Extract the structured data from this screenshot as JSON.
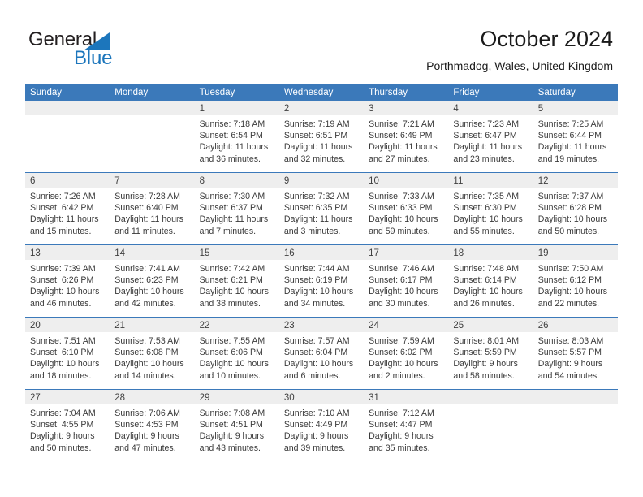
{
  "brand": {
    "name_top": "General",
    "name_bottom": "Blue",
    "triangle_icon": "triangle-icon",
    "color_text": "#231f20",
    "color_blue": "#1c76bc"
  },
  "header": {
    "title": "October 2024",
    "subtitle": "Porthmadog, Wales, United Kingdom"
  },
  "theme": {
    "header_blue": "#3b79ba",
    "day_band_gray": "#eeeeee",
    "text_color": "#3a3a3a"
  },
  "weekdays": [
    "Sunday",
    "Monday",
    "Tuesday",
    "Wednesday",
    "Thursday",
    "Friday",
    "Saturday"
  ],
  "weeks": [
    [
      {
        "day": "",
        "empty": true,
        "sunrise": "",
        "sunset": "",
        "daylight_a": "",
        "daylight_b": ""
      },
      {
        "day": "",
        "empty": true,
        "sunrise": "",
        "sunset": "",
        "daylight_a": "",
        "daylight_b": ""
      },
      {
        "day": "1",
        "sunrise": "Sunrise: 7:18 AM",
        "sunset": "Sunset: 6:54 PM",
        "daylight_a": "Daylight: 11 hours",
        "daylight_b": "and 36 minutes."
      },
      {
        "day": "2",
        "sunrise": "Sunrise: 7:19 AM",
        "sunset": "Sunset: 6:51 PM",
        "daylight_a": "Daylight: 11 hours",
        "daylight_b": "and 32 minutes."
      },
      {
        "day": "3",
        "sunrise": "Sunrise: 7:21 AM",
        "sunset": "Sunset: 6:49 PM",
        "daylight_a": "Daylight: 11 hours",
        "daylight_b": "and 27 minutes."
      },
      {
        "day": "4",
        "sunrise": "Sunrise: 7:23 AM",
        "sunset": "Sunset: 6:47 PM",
        "daylight_a": "Daylight: 11 hours",
        "daylight_b": "and 23 minutes."
      },
      {
        "day": "5",
        "sunrise": "Sunrise: 7:25 AM",
        "sunset": "Sunset: 6:44 PM",
        "daylight_a": "Daylight: 11 hours",
        "daylight_b": "and 19 minutes."
      }
    ],
    [
      {
        "day": "6",
        "sunrise": "Sunrise: 7:26 AM",
        "sunset": "Sunset: 6:42 PM",
        "daylight_a": "Daylight: 11 hours",
        "daylight_b": "and 15 minutes."
      },
      {
        "day": "7",
        "sunrise": "Sunrise: 7:28 AM",
        "sunset": "Sunset: 6:40 PM",
        "daylight_a": "Daylight: 11 hours",
        "daylight_b": "and 11 minutes."
      },
      {
        "day": "8",
        "sunrise": "Sunrise: 7:30 AM",
        "sunset": "Sunset: 6:37 PM",
        "daylight_a": "Daylight: 11 hours",
        "daylight_b": "and 7 minutes."
      },
      {
        "day": "9",
        "sunrise": "Sunrise: 7:32 AM",
        "sunset": "Sunset: 6:35 PM",
        "daylight_a": "Daylight: 11 hours",
        "daylight_b": "and 3 minutes."
      },
      {
        "day": "10",
        "sunrise": "Sunrise: 7:33 AM",
        "sunset": "Sunset: 6:33 PM",
        "daylight_a": "Daylight: 10 hours",
        "daylight_b": "and 59 minutes."
      },
      {
        "day": "11",
        "sunrise": "Sunrise: 7:35 AM",
        "sunset": "Sunset: 6:30 PM",
        "daylight_a": "Daylight: 10 hours",
        "daylight_b": "and 55 minutes."
      },
      {
        "day": "12",
        "sunrise": "Sunrise: 7:37 AM",
        "sunset": "Sunset: 6:28 PM",
        "daylight_a": "Daylight: 10 hours",
        "daylight_b": "and 50 minutes."
      }
    ],
    [
      {
        "day": "13",
        "sunrise": "Sunrise: 7:39 AM",
        "sunset": "Sunset: 6:26 PM",
        "daylight_a": "Daylight: 10 hours",
        "daylight_b": "and 46 minutes."
      },
      {
        "day": "14",
        "sunrise": "Sunrise: 7:41 AM",
        "sunset": "Sunset: 6:23 PM",
        "daylight_a": "Daylight: 10 hours",
        "daylight_b": "and 42 minutes."
      },
      {
        "day": "15",
        "sunrise": "Sunrise: 7:42 AM",
        "sunset": "Sunset: 6:21 PM",
        "daylight_a": "Daylight: 10 hours",
        "daylight_b": "and 38 minutes."
      },
      {
        "day": "16",
        "sunrise": "Sunrise: 7:44 AM",
        "sunset": "Sunset: 6:19 PM",
        "daylight_a": "Daylight: 10 hours",
        "daylight_b": "and 34 minutes."
      },
      {
        "day": "17",
        "sunrise": "Sunrise: 7:46 AM",
        "sunset": "Sunset: 6:17 PM",
        "daylight_a": "Daylight: 10 hours",
        "daylight_b": "and 30 minutes."
      },
      {
        "day": "18",
        "sunrise": "Sunrise: 7:48 AM",
        "sunset": "Sunset: 6:14 PM",
        "daylight_a": "Daylight: 10 hours",
        "daylight_b": "and 26 minutes."
      },
      {
        "day": "19",
        "sunrise": "Sunrise: 7:50 AM",
        "sunset": "Sunset: 6:12 PM",
        "daylight_a": "Daylight: 10 hours",
        "daylight_b": "and 22 minutes."
      }
    ],
    [
      {
        "day": "20",
        "sunrise": "Sunrise: 7:51 AM",
        "sunset": "Sunset: 6:10 PM",
        "daylight_a": "Daylight: 10 hours",
        "daylight_b": "and 18 minutes."
      },
      {
        "day": "21",
        "sunrise": "Sunrise: 7:53 AM",
        "sunset": "Sunset: 6:08 PM",
        "daylight_a": "Daylight: 10 hours",
        "daylight_b": "and 14 minutes."
      },
      {
        "day": "22",
        "sunrise": "Sunrise: 7:55 AM",
        "sunset": "Sunset: 6:06 PM",
        "daylight_a": "Daylight: 10 hours",
        "daylight_b": "and 10 minutes."
      },
      {
        "day": "23",
        "sunrise": "Sunrise: 7:57 AM",
        "sunset": "Sunset: 6:04 PM",
        "daylight_a": "Daylight: 10 hours",
        "daylight_b": "and 6 minutes."
      },
      {
        "day": "24",
        "sunrise": "Sunrise: 7:59 AM",
        "sunset": "Sunset: 6:02 PM",
        "daylight_a": "Daylight: 10 hours",
        "daylight_b": "and 2 minutes."
      },
      {
        "day": "25",
        "sunrise": "Sunrise: 8:01 AM",
        "sunset": "Sunset: 5:59 PM",
        "daylight_a": "Daylight: 9 hours",
        "daylight_b": "and 58 minutes."
      },
      {
        "day": "26",
        "sunrise": "Sunrise: 8:03 AM",
        "sunset": "Sunset: 5:57 PM",
        "daylight_a": "Daylight: 9 hours",
        "daylight_b": "and 54 minutes."
      }
    ],
    [
      {
        "day": "27",
        "sunrise": "Sunrise: 7:04 AM",
        "sunset": "Sunset: 4:55 PM",
        "daylight_a": "Daylight: 9 hours",
        "daylight_b": "and 50 minutes."
      },
      {
        "day": "28",
        "sunrise": "Sunrise: 7:06 AM",
        "sunset": "Sunset: 4:53 PM",
        "daylight_a": "Daylight: 9 hours",
        "daylight_b": "and 47 minutes."
      },
      {
        "day": "29",
        "sunrise": "Sunrise: 7:08 AM",
        "sunset": "Sunset: 4:51 PM",
        "daylight_a": "Daylight: 9 hours",
        "daylight_b": "and 43 minutes."
      },
      {
        "day": "30",
        "sunrise": "Sunrise: 7:10 AM",
        "sunset": "Sunset: 4:49 PM",
        "daylight_a": "Daylight: 9 hours",
        "daylight_b": "and 39 minutes."
      },
      {
        "day": "31",
        "sunrise": "Sunrise: 7:12 AM",
        "sunset": "Sunset: 4:47 PM",
        "daylight_a": "Daylight: 9 hours",
        "daylight_b": "and 35 minutes."
      },
      {
        "day": "",
        "empty": true,
        "sunrise": "",
        "sunset": "",
        "daylight_a": "",
        "daylight_b": ""
      },
      {
        "day": "",
        "empty": true,
        "sunrise": "",
        "sunset": "",
        "daylight_a": "",
        "daylight_b": ""
      }
    ]
  ]
}
